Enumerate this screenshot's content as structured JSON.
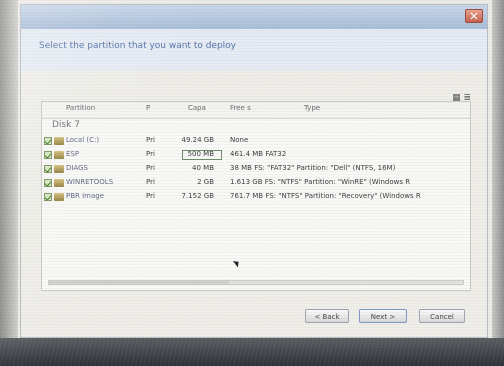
{
  "window": {
    "instruction": "Select the partition that you want to deploy",
    "close_icon": "close-icon"
  },
  "list": {
    "headers": {
      "partition": "Partition",
      "type": "P",
      "capacity": "Capa",
      "free": "Free s",
      "fs_type": "Type"
    },
    "disk_label": "Disk 7",
    "rows": [
      {
        "label": "Local (C:)",
        "type": "Pri",
        "capacity": "49.24 GB",
        "free": "None",
        "checked": true
      },
      {
        "label": "ESP",
        "type": "Pri",
        "capacity": "500 MB",
        "free": "461.4 MB FAT32",
        "checked": true
      },
      {
        "label": "DIAGS",
        "type": "Pri",
        "capacity": "40 MB",
        "free": "38 MB FS: \"FAT32\" Partition: \"Dell\" (NTFS, 16M)",
        "checked": true
      },
      {
        "label": "WINRETOOLS",
        "type": "Pri",
        "capacity": "2 GB",
        "free": "1.613 GB FS: \"NTFS\" Partition: \"WinRE\" (Windows R",
        "checked": true
      },
      {
        "label": "PBR Image",
        "type": "Pri",
        "capacity": "7.152 GB",
        "free": "761.7 MB FS: \"NTFS\" Partition: \"Recovery\" (Windows R",
        "checked": true
      }
    ]
  },
  "buttons": {
    "back": "< Back",
    "next": "Next >",
    "cancel": "Cancel"
  }
}
